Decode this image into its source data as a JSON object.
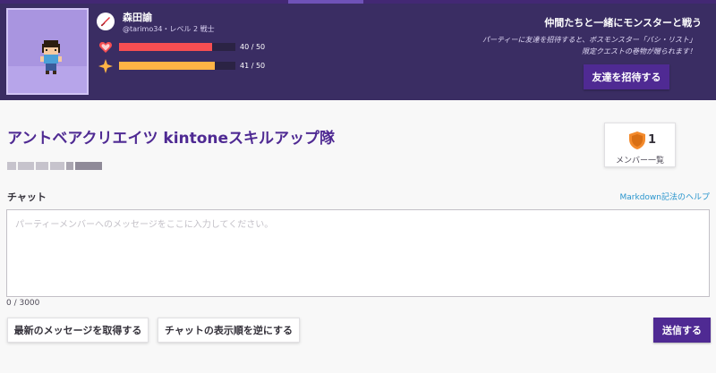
{
  "header": {
    "user": {
      "name": "森田諭",
      "handle_level": "@tarimo34・レベル 2 戦士",
      "class_icon": "sword-icon"
    },
    "stats": [
      {
        "icon": "heart-icon",
        "value": 40,
        "max": 50,
        "text": "40 / 50",
        "color": "#f74e52"
      },
      {
        "icon": "star-icon",
        "value": 41,
        "max": 50,
        "text": "41 / 50",
        "color": "#ffb445"
      }
    ],
    "promo": {
      "title": "仲間たちと一緒にモンスターと戦う",
      "text_line1": "パーティーに友達を招待すると、ボスモンスター「バシ・リスト」",
      "text_line2": "限定クエストの巻物が贈られます！",
      "invite_button": "友達を招待する"
    }
  },
  "party": {
    "title": "アントベアクリエイツ kintoneスキルアップ隊",
    "members": {
      "count": "1",
      "label": "メンバー一覧",
      "icon": "shield-icon"
    }
  },
  "chat": {
    "label": "チャット",
    "markdown_help": "Markdown記法のヘルプ",
    "placeholder": "パーティーメンバーへのメッセージをここに入力してください。",
    "value": "",
    "counter": "0 / 3000",
    "fetch_button": "最新のメッセージを取得する",
    "reverse_button": "チャットの表示順を逆にする",
    "send_button": "送信する"
  },
  "colors": {
    "header_bg": "#3a2d63",
    "accent": "#4f2a93",
    "link": "#2995cd",
    "health": "#f74e52",
    "experience": "#ffb445"
  }
}
